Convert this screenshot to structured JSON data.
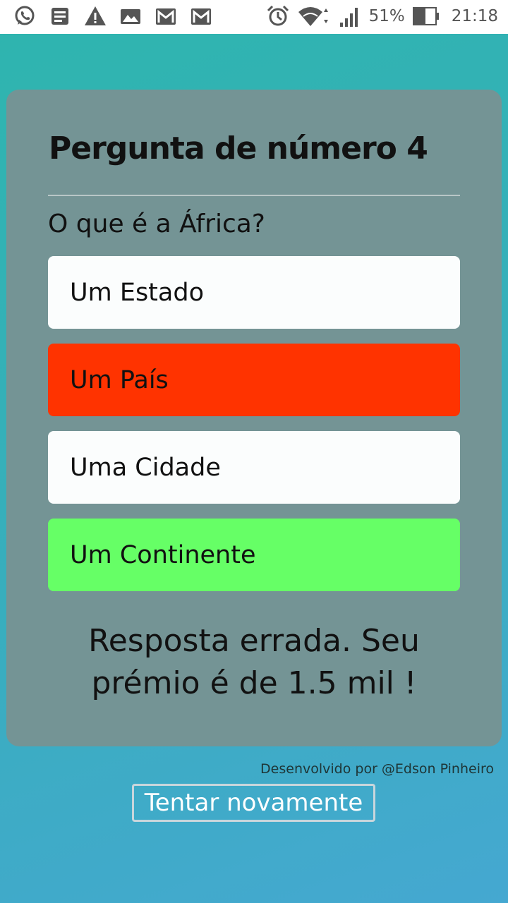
{
  "status_bar": {
    "battery": "51%",
    "time": "21:18",
    "notification_icons": [
      "whatsapp-icon",
      "news-icon",
      "warning-icon",
      "gallery-icon",
      "gmail-icon",
      "gmail-icon"
    ],
    "system_icons": [
      "alarm-icon",
      "wifi-icon",
      "signal-icon",
      "battery-icon"
    ]
  },
  "quiz": {
    "title": "Pergunta de número 4",
    "question": "O que é a África?",
    "answers": [
      {
        "label": "Um Estado",
        "state": "neutral",
        "color": "#fbfdfd"
      },
      {
        "label": "Um País",
        "state": "wrong",
        "color": "#ff3300"
      },
      {
        "label": "Uma Cidade",
        "state": "neutral",
        "color": "#fbfdfd"
      },
      {
        "label": "Um Continente",
        "state": "correct",
        "color": "#66ff66"
      }
    ],
    "result": "Resposta errada. Seu prémio é de 1.5 mil !"
  },
  "footer": {
    "credit": "Desenvolvido por @Edson Pinheiro",
    "retry_label": "Tentar novamente"
  },
  "colors": {
    "card": "#749495",
    "background_start": "#2eb5ae",
    "background_end": "#45a8d1"
  }
}
